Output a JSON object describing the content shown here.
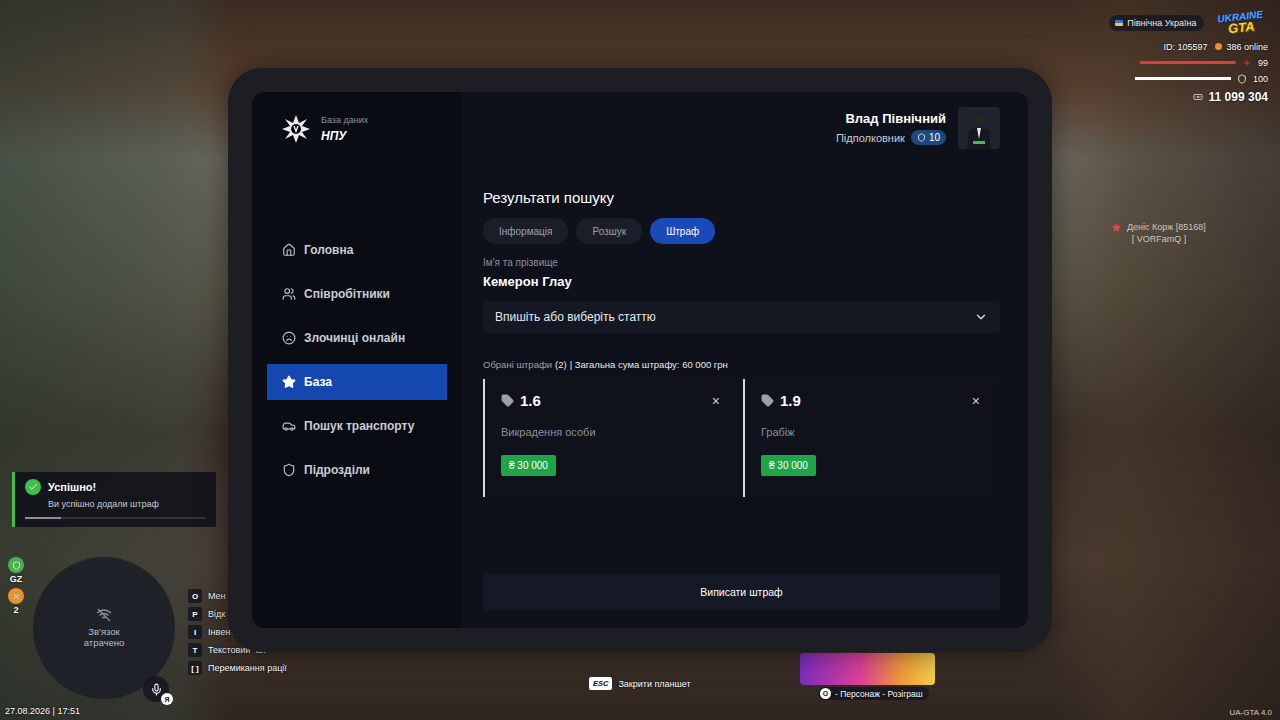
{
  "hud": {
    "region": "Північна Україна",
    "logo": {
      "top": "UKRAINE",
      "bottom": "GTA"
    },
    "player_id": "ID: 105597",
    "online": "386 online",
    "health": {
      "reading": "99",
      "level": 0.99
    },
    "armor": {
      "reading": "100",
      "level": 1
    },
    "money": "11 099 304",
    "name_tag": {
      "name": "Деніс Корж [85168]",
      "family": "[ VORFamQ ]"
    },
    "notification": {
      "title": "Успішно!",
      "text": "Ви успішно додали штраф",
      "level": 0.2
    },
    "status_icons": [
      {
        "label": "GZ",
        "color": "#4caf50"
      },
      {
        "label": "2",
        "color": "#e8912d"
      }
    ],
    "minimap": {
      "text": "Зв'язок атрачено"
    },
    "voice_badge": "Я",
    "key_hints": [
      {
        "key": "O",
        "label": "Мен"
      },
      {
        "key": "P",
        "label": "Відк"
      },
      {
        "key": "I",
        "label": "Інвент"
      },
      {
        "key": "T",
        "label": "Текстовий чат"
      },
      {
        "key": "[ ]",
        "label": "Перемикання рації"
      }
    ],
    "close_hint": {
      "key": "ESC",
      "label": "Закрити планшет"
    },
    "promo": {
      "key": "O",
      "label": "- Персонаж - Розіграш"
    },
    "datetime": "27.08.2026 | 17:51",
    "version": "UA-GTA 4.0"
  },
  "tablet": {
    "brand": {
      "subtitle": "База даних",
      "title": "НПУ"
    },
    "sidebar": {
      "items": [
        {
          "label": "Головна",
          "selected": false
        },
        {
          "label": "Співробітники",
          "selected": false
        },
        {
          "label": "Злочинці онлайн",
          "selected": false
        },
        {
          "label": "База",
          "selected": true
        },
        {
          "label": "Пошук транспорту",
          "selected": false
        },
        {
          "label": "Підрозділи",
          "selected": false
        }
      ]
    },
    "user": {
      "name": "Влад Північний",
      "rank": "Підполковник",
      "level": "10"
    },
    "title": "Результати пошуку",
    "tabs": [
      {
        "label": "Інформація",
        "selected": false
      },
      {
        "label": "Розшук",
        "selected": false
      },
      {
        "label": "Штраф",
        "selected": true
      }
    ],
    "person": {
      "label": "Ім'я та прізвище",
      "name": "Кемерон Глау"
    },
    "article_select": {
      "placeholder": "Впишіть або виберіть статтю"
    },
    "summary": {
      "label": "Обрані штрафи",
      "count": "(2)",
      "total": "| Загальна сума штрафу: 60 000 грн"
    },
    "fines": [
      {
        "article": "1.6",
        "title": "Викрадення особи",
        "amount": "₴ 30 000",
        "remove": "×"
      },
      {
        "article": "1.9",
        "title": "Грабіж",
        "amount": "₴ 30 000",
        "remove": "×"
      }
    ],
    "submit": "Виписати штраф"
  }
}
